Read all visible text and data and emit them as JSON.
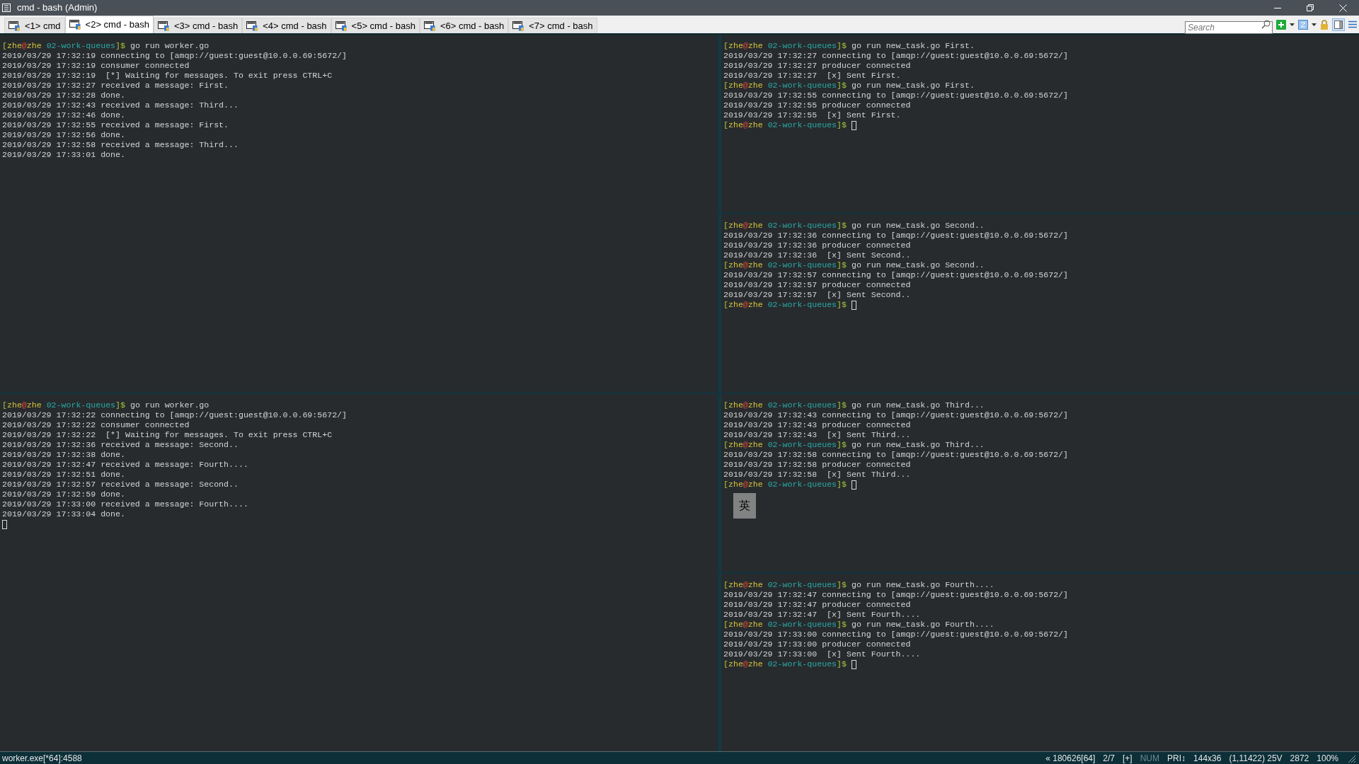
{
  "window": {
    "title": "cmd - bash (Admin)"
  },
  "tabs": [
    {
      "label": "<1> cmd",
      "selected": false
    },
    {
      "label": "<2> cmd - bash",
      "selected": true
    },
    {
      "label": "<3> cmd - bash",
      "selected": false
    },
    {
      "label": "<4> cmd - bash",
      "selected": false
    },
    {
      "label": "<5> cmd - bash",
      "selected": false
    },
    {
      "label": "<6> cmd - bash",
      "selected": false
    },
    {
      "label": "<7> cmd - bash",
      "selected": false
    }
  ],
  "search": {
    "placeholder": "Search"
  },
  "left_panes": [
    {
      "lines": [
        {
          "kind": "prompt",
          "open": "[",
          "user": "zhe",
          "at": "@",
          "host": "zhe",
          "dir": "02-work-queues",
          "close": "]$",
          "command": " go run worker.go"
        },
        {
          "kind": "output",
          "text": "2019/03/29 17:32:19 connecting to [amqp://guest:guest@10.0.0.69:5672/]"
        },
        {
          "kind": "output",
          "text": "2019/03/29 17:32:19 consumer connected"
        },
        {
          "kind": "output",
          "text": "2019/03/29 17:32:19  [*] Waiting for messages. To exit press CTRL+C"
        },
        {
          "kind": "output",
          "text": "2019/03/29 17:32:27 received a message: First."
        },
        {
          "kind": "output",
          "text": "2019/03/29 17:32:28 done."
        },
        {
          "kind": "output",
          "text": "2019/03/29 17:32:43 received a message: Third..."
        },
        {
          "kind": "output",
          "text": "2019/03/29 17:32:46 done."
        },
        {
          "kind": "output",
          "text": "2019/03/29 17:32:55 received a message: First."
        },
        {
          "kind": "output",
          "text": "2019/03/29 17:32:56 done."
        },
        {
          "kind": "output",
          "text": "2019/03/29 17:32:58 received a message: Third..."
        },
        {
          "kind": "output",
          "text": "2019/03/29 17:33:01 done."
        }
      ]
    },
    {
      "lines": [
        {
          "kind": "prompt",
          "open": "[",
          "user": "zhe",
          "at": "@",
          "host": "zhe",
          "dir": "02-work-queues",
          "close": "]$",
          "command": " go run worker.go"
        },
        {
          "kind": "output",
          "text": "2019/03/29 17:32:22 connecting to [amqp://guest:guest@10.0.0.69:5672/]"
        },
        {
          "kind": "output",
          "text": "2019/03/29 17:32:22 consumer connected"
        },
        {
          "kind": "output",
          "text": "2019/03/29 17:32:22  [*] Waiting for messages. To exit press CTRL+C"
        },
        {
          "kind": "output",
          "text": "2019/03/29 17:32:36 received a message: Second.."
        },
        {
          "kind": "output",
          "text": "2019/03/29 17:32:38 done."
        },
        {
          "kind": "output",
          "text": "2019/03/29 17:32:47 received a message: Fourth...."
        },
        {
          "kind": "output",
          "text": "2019/03/29 17:32:51 done."
        },
        {
          "kind": "output",
          "text": "2019/03/29 17:32:57 received a message: Second.."
        },
        {
          "kind": "output",
          "text": "2019/03/29 17:32:59 done."
        },
        {
          "kind": "output",
          "text": "2019/03/29 17:33:00 received a message: Fourth...."
        },
        {
          "kind": "output",
          "text": "2019/03/29 17:33:04 done."
        },
        {
          "kind": "cursor"
        }
      ]
    }
  ],
  "right_panes": [
    {
      "lines": [
        {
          "kind": "prompt",
          "open": "[",
          "user": "zhe",
          "at": "@",
          "host": "zhe",
          "dir": "02-work-queues",
          "close": "]$",
          "command": " go run new_task.go First."
        },
        {
          "kind": "output",
          "text": "2019/03/29 17:32:27 connecting to [amqp://guest:guest@10.0.0.69:5672/]"
        },
        {
          "kind": "output",
          "text": "2019/03/29 17:32:27 producer connected"
        },
        {
          "kind": "output",
          "text": "2019/03/29 17:32:27  [x] Sent First."
        },
        {
          "kind": "prompt",
          "open": "[",
          "user": "zhe",
          "at": "@",
          "host": "zhe",
          "dir": "02-work-queues",
          "close": "]$",
          "command": " go run new_task.go First."
        },
        {
          "kind": "output",
          "text": "2019/03/29 17:32:55 connecting to [amqp://guest:guest@10.0.0.69:5672/]"
        },
        {
          "kind": "output",
          "text": "2019/03/29 17:32:55 producer connected"
        },
        {
          "kind": "output",
          "text": "2019/03/29 17:32:55  [x] Sent First."
        },
        {
          "kind": "prompt",
          "open": "[",
          "user": "zhe",
          "at": "@",
          "host": "zhe",
          "dir": "02-work-queues",
          "close": "]$",
          "cursor": true
        }
      ]
    },
    {
      "lines": [
        {
          "kind": "prompt",
          "open": "[",
          "user": "zhe",
          "at": "@",
          "host": "zhe",
          "dir": "02-work-queues",
          "close": "]$",
          "command": " go run new_task.go Second.."
        },
        {
          "kind": "output",
          "text": "2019/03/29 17:32:36 connecting to [amqp://guest:guest@10.0.0.69:5672/]"
        },
        {
          "kind": "output",
          "text": "2019/03/29 17:32:36 producer connected"
        },
        {
          "kind": "output",
          "text": "2019/03/29 17:32:36  [x] Sent Second.."
        },
        {
          "kind": "prompt",
          "open": "[",
          "user": "zhe",
          "at": "@",
          "host": "zhe",
          "dir": "02-work-queues",
          "close": "]$",
          "command": " go run new_task.go Second.."
        },
        {
          "kind": "output",
          "text": "2019/03/29 17:32:57 connecting to [amqp://guest:guest@10.0.0.69:5672/]"
        },
        {
          "kind": "output",
          "text": "2019/03/29 17:32:57 producer connected"
        },
        {
          "kind": "output",
          "text": "2019/03/29 17:32:57  [x] Sent Second.."
        },
        {
          "kind": "prompt",
          "open": "[",
          "user": "zhe",
          "at": "@",
          "host": "zhe",
          "dir": "02-work-queues",
          "close": "]$",
          "cursor": true
        }
      ]
    },
    {
      "ime_indicator": "英",
      "lines": [
        {
          "kind": "prompt",
          "open": "[",
          "user": "zhe",
          "at": "@",
          "host": "zhe",
          "dir": "02-work-queues",
          "close": "]$",
          "command": " go run new_task.go Third..."
        },
        {
          "kind": "output",
          "text": "2019/03/29 17:32:43 connecting to [amqp://guest:guest@10.0.0.69:5672/]"
        },
        {
          "kind": "output",
          "text": "2019/03/29 17:32:43 producer connected"
        },
        {
          "kind": "output",
          "text": "2019/03/29 17:32:43  [x] Sent Third..."
        },
        {
          "kind": "prompt",
          "open": "[",
          "user": "zhe",
          "at": "@",
          "host": "zhe",
          "dir": "02-work-queues",
          "close": "]$",
          "command": " go run new_task.go Third..."
        },
        {
          "kind": "output",
          "text": "2019/03/29 17:32:58 connecting to [amqp://guest:guest@10.0.0.69:5672/]"
        },
        {
          "kind": "output",
          "text": "2019/03/29 17:32:58 producer connected"
        },
        {
          "kind": "output",
          "text": "2019/03/29 17:32:58  [x] Sent Third..."
        },
        {
          "kind": "prompt",
          "open": "[",
          "user": "zhe",
          "at": "@",
          "host": "zhe",
          "dir": "02-work-queues",
          "close": "]$",
          "cursor": true
        }
      ]
    },
    {
      "lines": [
        {
          "kind": "prompt",
          "open": "[",
          "user": "zhe",
          "at": "@",
          "host": "zhe",
          "dir": "02-work-queues",
          "close": "]$",
          "command": " go run new_task.go Fourth...."
        },
        {
          "kind": "output",
          "text": "2019/03/29 17:32:47 connecting to [amqp://guest:guest@10.0.0.69:5672/]"
        },
        {
          "kind": "output",
          "text": "2019/03/29 17:32:47 producer connected"
        },
        {
          "kind": "output",
          "text": "2019/03/29 17:32:47  [x] Sent Fourth...."
        },
        {
          "kind": "prompt",
          "open": "[",
          "user": "zhe",
          "at": "@",
          "host": "zhe",
          "dir": "02-work-queues",
          "close": "]$",
          "command": " go run new_task.go Fourth...."
        },
        {
          "kind": "output",
          "text": "2019/03/29 17:33:00 connecting to [amqp://guest:guest@10.0.0.69:5672/]"
        },
        {
          "kind": "output",
          "text": "2019/03/29 17:33:00 producer connected"
        },
        {
          "kind": "output",
          "text": "2019/03/29 17:33:00  [x] Sent Fourth...."
        },
        {
          "kind": "prompt",
          "open": "[",
          "user": "zhe",
          "at": "@",
          "host": "zhe",
          "dir": "02-work-queues",
          "close": "]$",
          "cursor": true
        }
      ]
    }
  ],
  "status_bar": {
    "process": "worker.exe[*64]:4588",
    "items": [
      {
        "text": "« 180626[64]",
        "disabled": false
      },
      {
        "text": "2/7",
        "disabled": false
      },
      {
        "text": "[+]",
        "disabled": false
      },
      {
        "text": "NUM",
        "disabled": true
      },
      {
        "text": "PRI↕",
        "disabled": false
      },
      {
        "text": "144x36",
        "disabled": false
      },
      {
        "text": "(1,11422) 25V",
        "disabled": false
      },
      {
        "text": "2872",
        "disabled": false
      },
      {
        "text": "100%",
        "disabled": false
      }
    ]
  }
}
